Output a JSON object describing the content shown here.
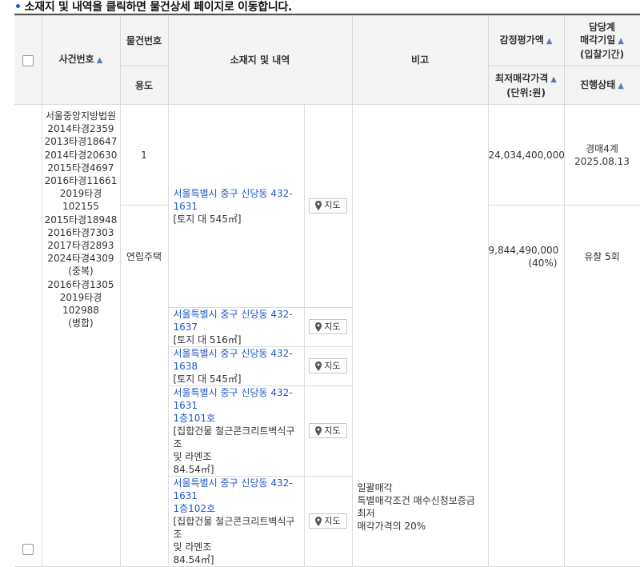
{
  "notice": "소재지 및 내역을 클릭하면 물건상세 페이지로 이동합니다.",
  "headers": {
    "case_no": "사건번호",
    "item_no": "물건번호",
    "usage": "용도",
    "location": "소재지 및 내역",
    "remark": "비고",
    "appraisal": "감정평가액",
    "min_price": "최저매각가격",
    "min_price_unit": "(단위:원)",
    "dept_line1": "담당계",
    "dept_line2": "매각기일",
    "dept_line3": "(입찰기간)",
    "status": "진행상태"
  },
  "sort_arrow": "▲",
  "row": {
    "cases": [
      "서울중앙지방법원",
      "2014타경2359",
      "2013타경18647",
      "2014타경20630",
      "2015타경4697",
      "2016타경11661",
      "2019타경102155",
      "2015타경18948",
      "2016타경7303",
      "2017타경2893",
      "2024타경4309",
      "(중복)",
      "2016타경1305",
      "2019타경102988",
      "(병합)"
    ],
    "item_no": "1",
    "usage": "연립주택",
    "appraisal": "24,034,400,000",
    "min_price": "9,844,490,000",
    "min_price_pct": "(40%)",
    "dept": "경매4계",
    "sale_date": "2025.08.13",
    "status": "유찰 5회",
    "map_label": "지도",
    "addresses": [
      {
        "link": "서울특별시 중구 신당동 432-1631",
        "detail": "[토지 대 545㎡]"
      },
      {
        "link": "서울특별시 중구 신당동 432-1637",
        "detail": "[토지 대 516㎡]"
      },
      {
        "link": "서울특별시 중구 신당동 432-1638",
        "detail": "[토지 대 545㎡]"
      },
      {
        "link": "서울특별시 중구 신당동 432-1631",
        "link2": "1층101호",
        "detail": "[집합건물 철근콘크리트벽식구조",
        "detail2": "및 라멘조",
        "detail3": "84.54㎡]"
      },
      {
        "link": "서울특별시 중구 신당동 432-1631",
        "link2": "1층102호",
        "detail": "[집합건물 철근콘크리트벽식구조",
        "detail2": "및 라멘조",
        "detail3": "84.54㎡]"
      }
    ],
    "remark_lines": [
      "일괄매각",
      "특별매각조건 매수신청보증금 최저",
      "매각가격의 20%"
    ]
  }
}
